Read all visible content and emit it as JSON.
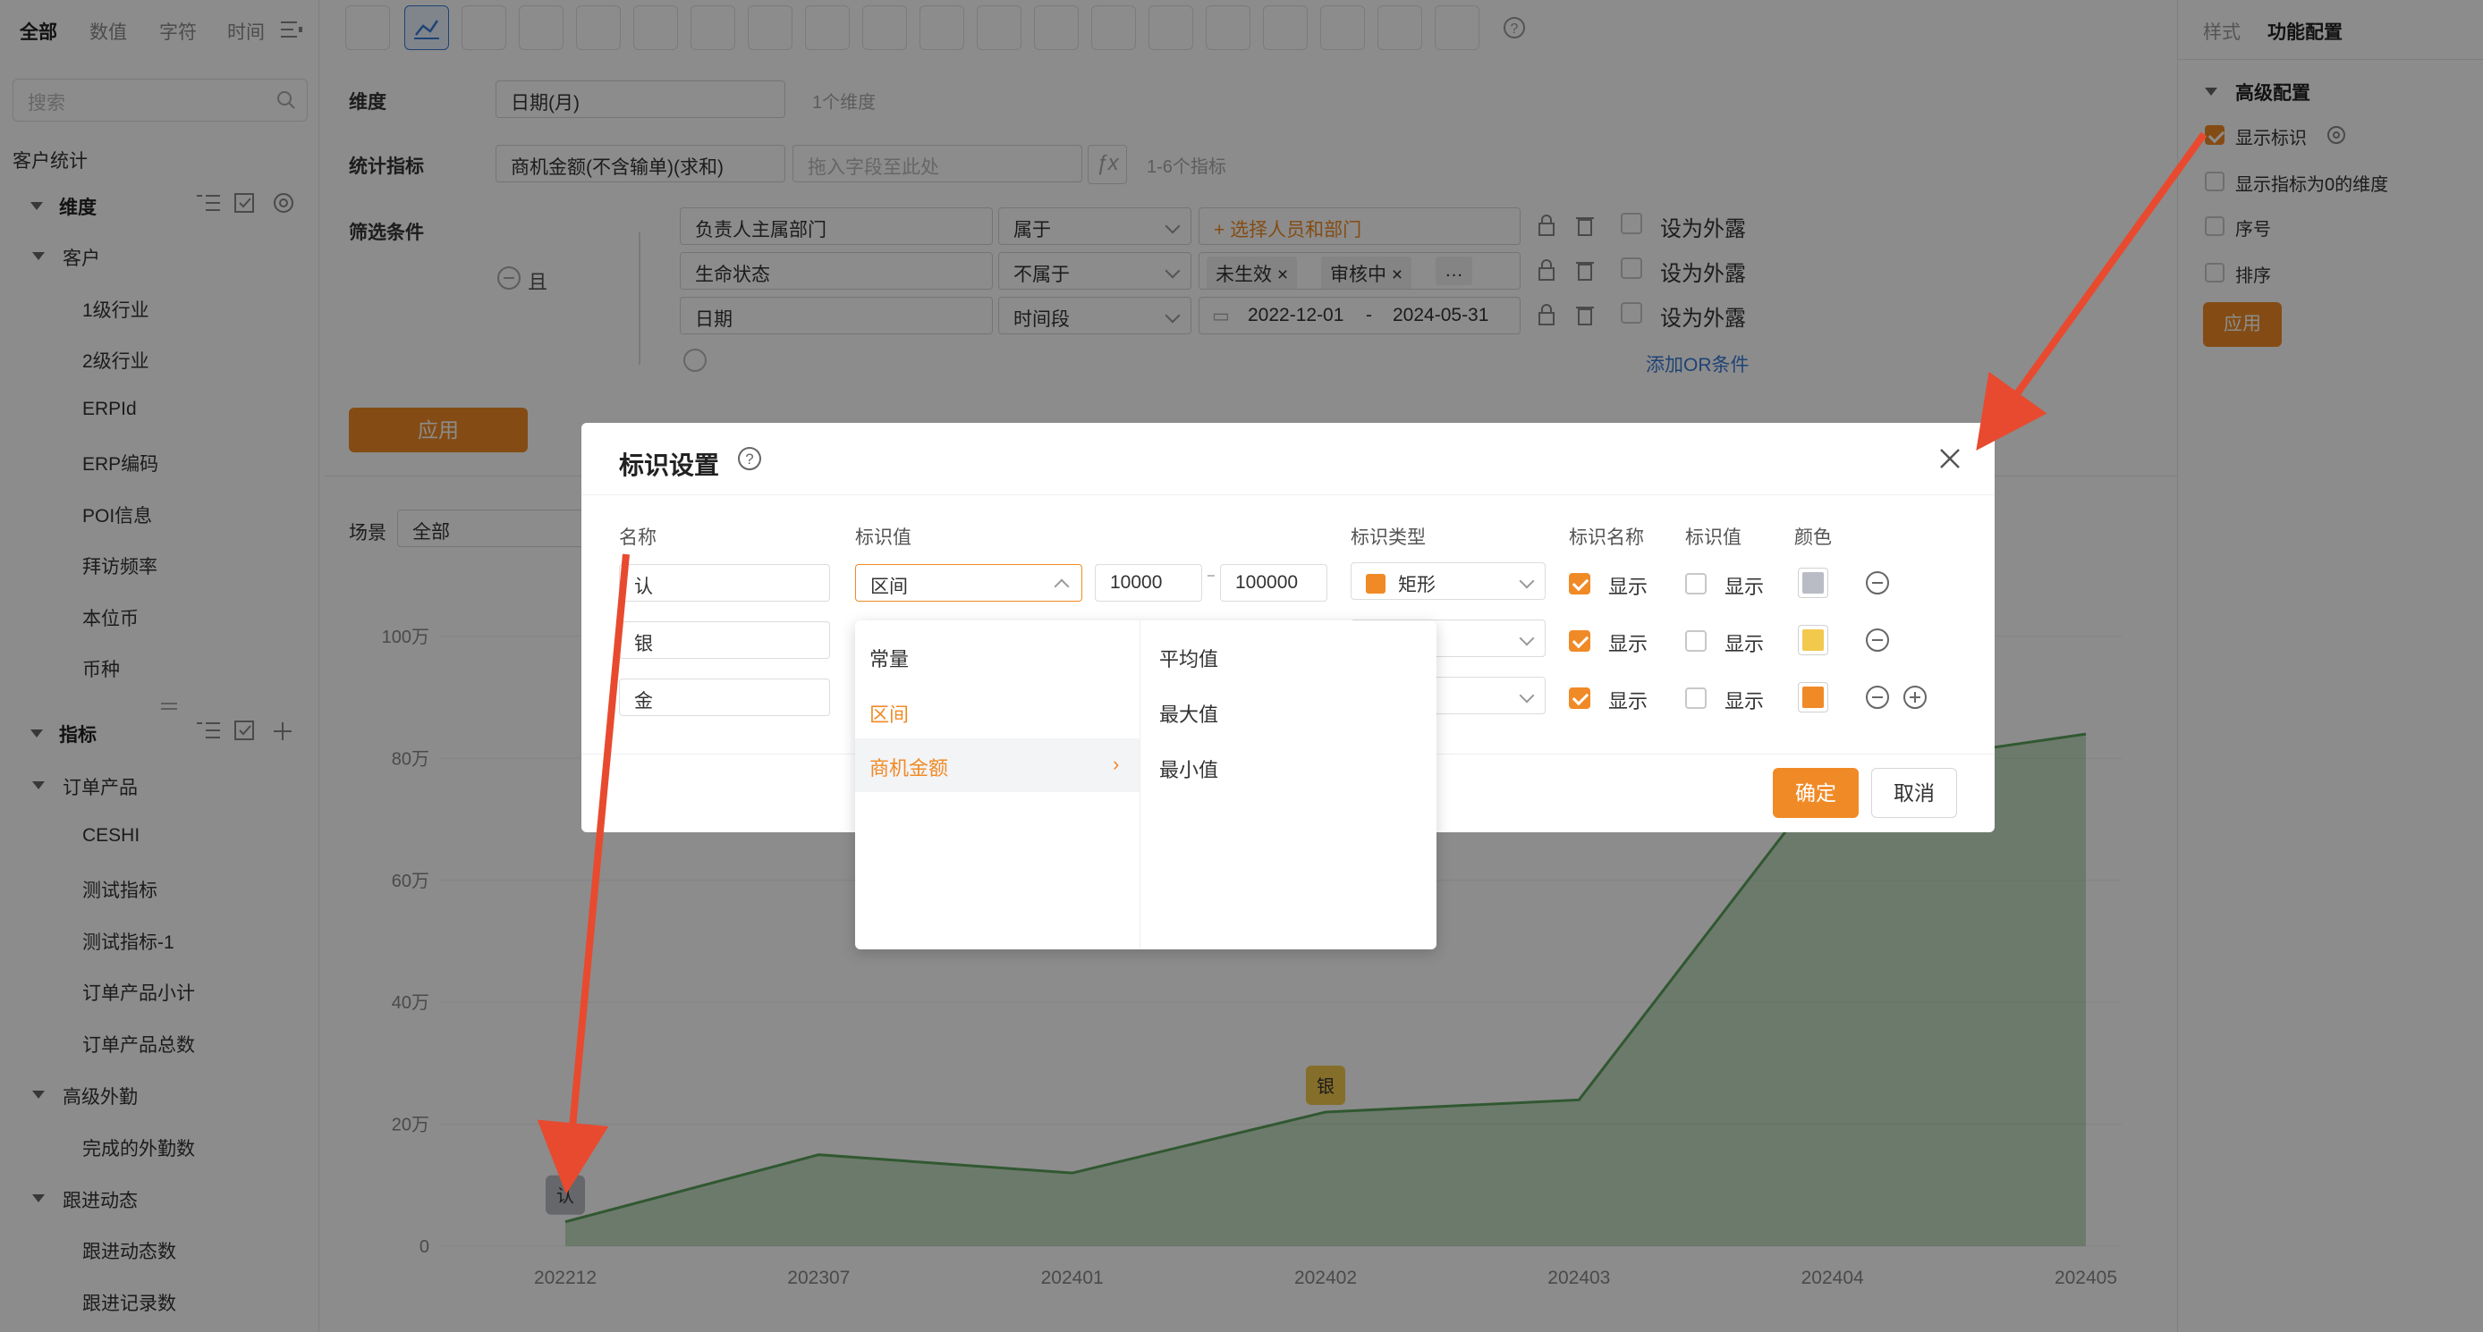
{
  "left_panel": {
    "tabs": [
      "全部",
      "数值",
      "字符",
      "时间"
    ],
    "search_placeholder": "搜索",
    "section_title": "客户统计",
    "dimension_group": "维度",
    "customer_group": "客户",
    "dimension_items": [
      "1级行业",
      "2级行业",
      "ERPId",
      "ERP编码",
      "POI信息",
      "拜访频率",
      "本位币",
      "币种"
    ],
    "metric_group": "指标",
    "order_group": "订单产品",
    "order_items": [
      "CESHI",
      "测试指标",
      "测试指标-1",
      "订单产品小计",
      "订单产品总数"
    ],
    "field_group": "高级外勤",
    "field_items": [
      "完成的外勤数"
    ],
    "follow_group": "跟进动态",
    "follow_items": [
      "跟进动态数",
      "跟进记录数"
    ]
  },
  "config": {
    "dimension_label": "维度",
    "dimension_value": "日期(月)",
    "dimension_hint": "1个维度",
    "metric_label": "统计指标",
    "metric_value": "商机金额(不含输单)(求和)",
    "metric_placeholder": "拖入字段至此处",
    "fx_label": "ƒx",
    "metric_hint": "1-6个指标",
    "filter_label": "筛选条件",
    "and_label": "且",
    "filters": [
      {
        "field": "负责人主属部门",
        "op": "属于",
        "value": "+ 选择人员和部门",
        "expose": "设为外露"
      },
      {
        "field": "生命状态",
        "op": "不属于",
        "tags": [
          "未生效",
          "审核中",
          "…"
        ],
        "expose": "设为外露"
      },
      {
        "field": "日期",
        "op": "时间段",
        "start": "2022-12-01",
        "sep": "-",
        "end": "2024-05-31",
        "expose": "设为外露"
      }
    ],
    "add_or": "添加OR条件",
    "apply": "应用",
    "scene_label": "场景",
    "scene_value": "全部"
  },
  "right_panel": {
    "tab_style": "样式",
    "tab_func": "功能配置",
    "section": "高级配置",
    "options": [
      {
        "label": "显示标识",
        "checked": true
      },
      {
        "label": "显示指标为0的维度",
        "checked": false
      },
      {
        "label": "序号",
        "checked": false
      },
      {
        "label": "排序",
        "checked": false
      }
    ],
    "apply": "应用"
  },
  "chart_data": {
    "type": "area",
    "categories": [
      "202212",
      "202307",
      "202401",
      "202402",
      "202403",
      "202404",
      "202405"
    ],
    "values": [
      40000,
      150000,
      120000,
      220000,
      240000,
      780000,
      840000
    ],
    "ylim": [
      0,
      1000000
    ],
    "yticks": [
      "0",
      "20万",
      "40万",
      "60万",
      "80万",
      "100万"
    ],
    "markers": [
      {
        "label": "认",
        "category": "202212"
      },
      {
        "label": "银",
        "category": "202402"
      }
    ],
    "color": "#5aa05a"
  },
  "modal": {
    "title": "标识设置",
    "headers": {
      "name": "名称",
      "value": "标识值",
      "type": "标识类型",
      "show_name": "标识名称",
      "show_value": "标识值",
      "color": "颜色"
    },
    "rows": [
      {
        "name": "认",
        "value_mode": "区间",
        "min": "10000",
        "max": "100000",
        "type": "矩形",
        "show_name": "显示",
        "show_value": "显示",
        "color": "#b9bcc4"
      },
      {
        "name": "银",
        "show_name": "显示",
        "show_value": "显示",
        "color": "#f2c94c"
      },
      {
        "name": "金",
        "show_name": "显示",
        "show_value": "显示",
        "color": "#f08a26"
      }
    ],
    "ok": "确定",
    "cancel": "取消"
  },
  "dropdown": {
    "left": [
      "常量",
      "区间",
      "商机金额"
    ],
    "right": [
      "平均值",
      "最大值",
      "最小值"
    ]
  }
}
